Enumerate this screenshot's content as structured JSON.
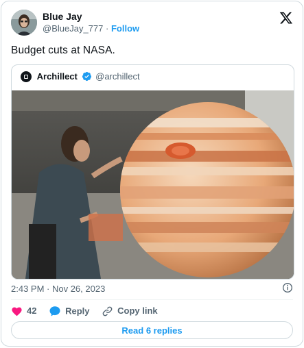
{
  "author": {
    "name": "Blue Jay",
    "handle": "@BlueJay_777",
    "separator": "·",
    "follow_label": "Follow"
  },
  "tweet": {
    "text": "Budget cuts at NASA."
  },
  "quoted": {
    "name": "Archillect",
    "handle": "@archillect",
    "image_description_icon": "photo-of-man-painting-giant-jupiter-model"
  },
  "meta": {
    "timestamp": "2:43 PM · Nov 26, 2023"
  },
  "actions": {
    "likes_count": "42",
    "reply_label": "Reply",
    "copy_link_label": "Copy link"
  },
  "footer": {
    "read_replies_label": "Read 6 replies"
  },
  "colors": {
    "accent": "#1d9bf0",
    "like": "#f91880",
    "secondary_text": "#536471",
    "border": "#cfd9de"
  }
}
